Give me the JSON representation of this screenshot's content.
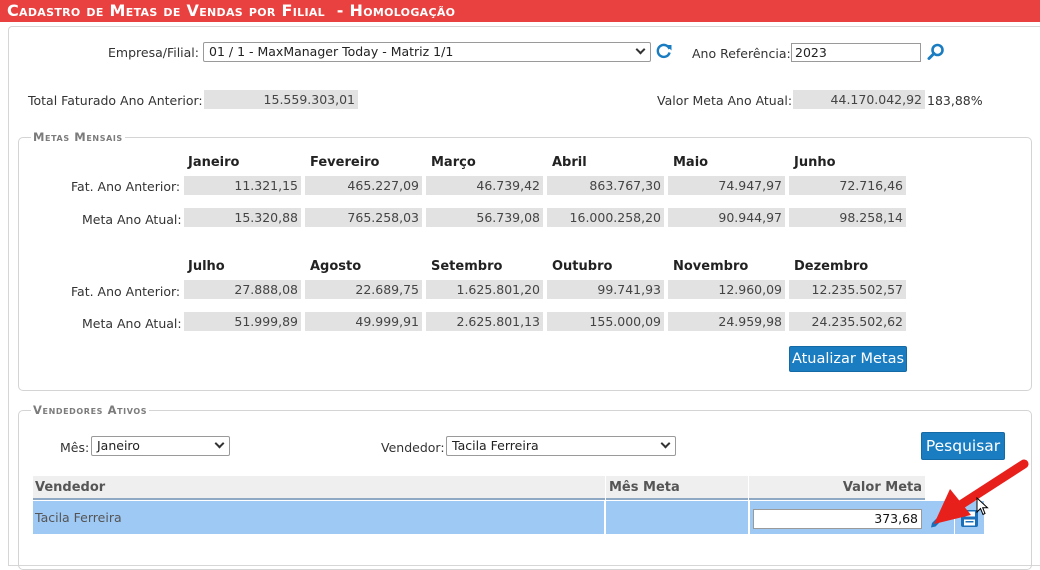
{
  "title": "Cadastro de Metas de Vendas por Filial  - Homologação",
  "top": {
    "empresa_label": "Empresa/Filial:",
    "empresa_value": "01 / 1 - MaxManager Today - Matriz 1/1",
    "ano_label": "Ano Referência:",
    "ano_value": "2023",
    "total_label": "Total Faturado Ano Anterior:",
    "total_value": "15.559.303,01",
    "meta_label": "Valor Meta Ano Atual:",
    "meta_value": "44.170.042,92",
    "meta_pct": "183,88%"
  },
  "metas": {
    "legend": "Metas Mensais",
    "row_fat_label": "Fat. Ano Anterior:",
    "row_meta_label": "Meta Ano Atual:",
    "block1": {
      "months": [
        "Janeiro",
        "Fevereiro",
        "Março",
        "Abril",
        "Maio",
        "Junho"
      ],
      "fat": [
        "11.321,15",
        "465.227,09",
        "46.739,42",
        "863.767,30",
        "74.947,97",
        "72.716,46"
      ],
      "meta": [
        "15.320,88",
        "765.258,03",
        "56.739,08",
        "16.000.258,20",
        "90.944,97",
        "98.258,14"
      ]
    },
    "block2": {
      "months": [
        "Julho",
        "Agosto",
        "Setembro",
        "Outubro",
        "Novembro",
        "Dezembro"
      ],
      "fat": [
        "27.888,08",
        "22.689,75",
        "1.625.801,20",
        "99.741,93",
        "12.960,09",
        "12.235.502,57"
      ],
      "meta": [
        "51.999,89",
        "49.999,91",
        "2.625.801,13",
        "155.000,09",
        "24.959,98",
        "24.235.502,62"
      ]
    },
    "update_button": "Atualizar Metas"
  },
  "vendedores": {
    "legend": "Vendedores Ativos",
    "mes_label": "Mês:",
    "mes_value": "Janeiro",
    "vendedor_label": "Vendedor:",
    "vendedor_value": "Tacila Ferreira",
    "search_button": "Pesquisar",
    "columns": [
      "Vendedor",
      "Mês Meta",
      "Valor Meta"
    ],
    "rows": [
      {
        "vendedor": "Tacila Ferreira",
        "mes_meta": "",
        "valor_meta": "373,68"
      }
    ]
  },
  "icons": {
    "refresh": "refresh-icon",
    "search": "magnifier-icon",
    "edit": "pencil-icon",
    "save": "floppy-disk-icon"
  },
  "colors": {
    "title_bar": "#e8413f",
    "button": "#1a7cc1",
    "selected_row": "#9ec9f4",
    "annotation_arrow": "#e8201c"
  }
}
